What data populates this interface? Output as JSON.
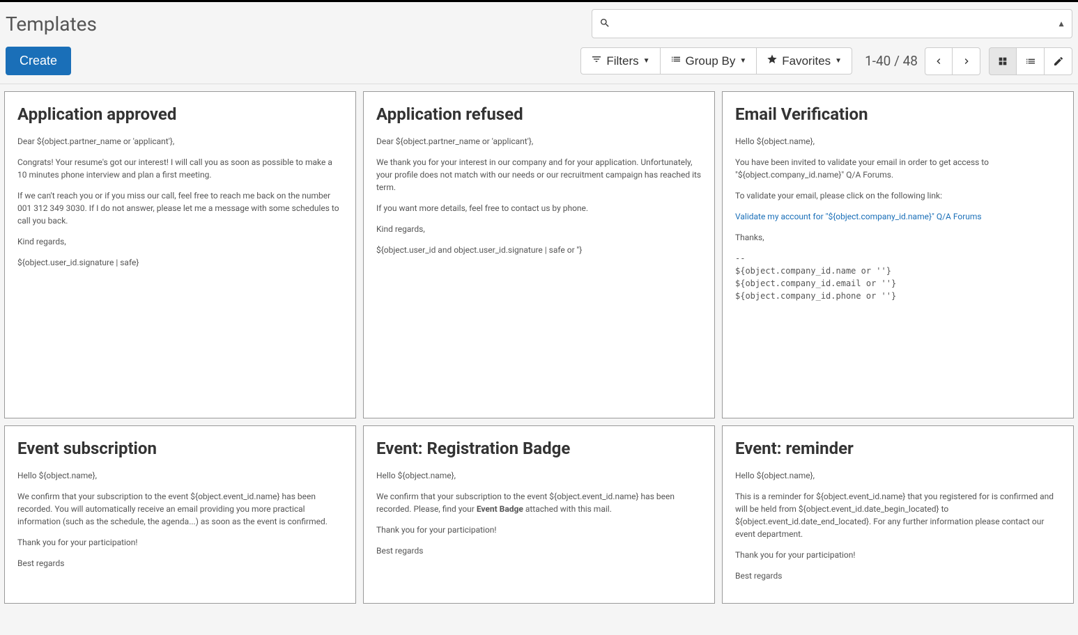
{
  "page_title": "Templates",
  "create_button": "Create",
  "search": {
    "placeholder": ""
  },
  "filters": {
    "filters_label": "Filters",
    "groupby_label": "Group By",
    "favorites_label": "Favorites"
  },
  "pager": {
    "text": "1-40 / 48"
  },
  "cards": [
    {
      "title": "Application approved",
      "body": [
        "Dear ${object.partner_name or 'applicant'},",
        "Congrats! Your resume's got our interest! I will call you as soon as possible to make a 10 minutes phone interview and plan a first meeting.",
        "If we can't reach you or if you miss our call, feel free to reach me back on the number 001 312 349 3030. If I do not answer, please let me a message with some schedules to call you back.",
        "Kind regards,",
        "${object.user_id.signature | safe}"
      ]
    },
    {
      "title": "Application refused",
      "body": [
        "Dear ${object.partner_name or 'applicant'},",
        "We thank you for your interest in our company and for your application. Unfortunately, your profile does not match with our needs or our recruitment campaign has reached its term.",
        "If you want more details, feel free to contact us by phone.",
        "Kind regards,",
        "${object.user_id and object.user_id.signature | safe or ''}"
      ]
    },
    {
      "title": "Email Verification",
      "body_intro": [
        "Hello ${object.name},",
        "You have been invited to validate your email in order to get access to \"${object.company_id.name}\" Q/A Forums.",
        "To validate your email, please click on the following link:"
      ],
      "link_text": "Validate my account for \"${object.company_id.name}\" Q/A Forums",
      "body_outro": [
        "Thanks,"
      ],
      "pre": "--\n${object.company_id.name or ''}\n${object.company_id.email or ''}\n${object.company_id.phone or ''}"
    },
    {
      "title": "Event subscription",
      "body": [
        "Hello ${object.name},",
        "We confirm that your subscription to the event ${object.event_id.name} has been recorded. You will automatically receive an email providing you more practical information (such as the schedule, the agenda...) as soon as the event is confirmed.",
        "Thank you for your participation!",
        "Best regards"
      ]
    },
    {
      "title": "Event: Registration Badge",
      "body_pre": "Hello ${object.name},",
      "body_main_pre": "We confirm that your subscription to the event ${object.event_id.name} has been recorded. Please, find your ",
      "body_main_bold": "Event Badge",
      "body_main_post": " attached with this mail.",
      "body_after": [
        "Thank you for your participation!",
        "Best regards"
      ]
    },
    {
      "title": "Event: reminder",
      "body": [
        "Hello ${object.name},",
        "This is a reminder for ${object.event_id.name} that you registered for is confirmed and will be held from ${object.event_id.date_begin_located} to ${object.event_id.date_end_located}. For any further information please contact our event department.",
        "Thank you for your participation!",
        "Best regards"
      ]
    }
  ]
}
